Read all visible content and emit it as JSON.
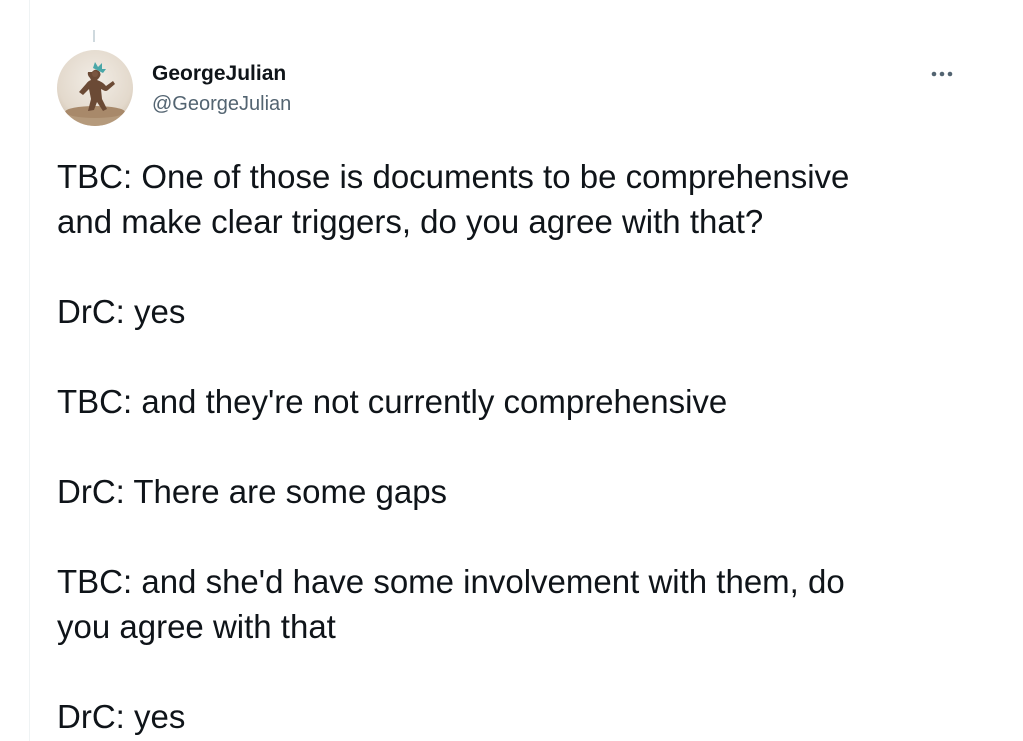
{
  "tweet": {
    "display_name": "GeorgeJulian",
    "handle": "@GeorgeJulian",
    "more_icon": "more-horizontal-icon",
    "avatar_icon": "user-avatar",
    "paragraphs": [
      "TBC: One of those is documents to be comprehensive\nand make clear triggers, do you agree with that?",
      "DrC: yes",
      "TBC: and they're not currently comprehensive",
      "DrC: There are some gaps",
      "TBC: and she'd have some involvement with them, do\nyou agree with that",
      "DrC: yes"
    ]
  },
  "colors": {
    "text_primary": "#0f1419",
    "text_secondary": "#536471",
    "border": "#eff3f4"
  }
}
